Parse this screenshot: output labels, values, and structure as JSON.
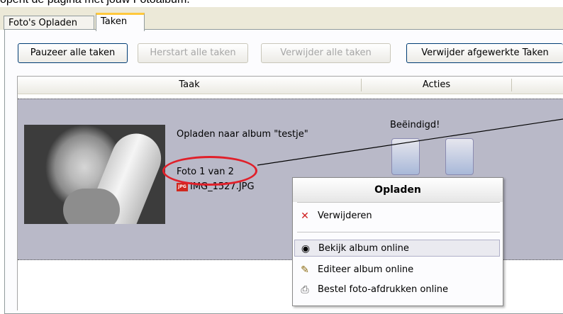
{
  "top_text": "opent de pagina met jouw Fotoalbum.",
  "tabs": [
    {
      "label": "Foto's Opladen"
    },
    {
      "label": "Taken"
    }
  ],
  "buttons": {
    "pause_all": "Pauzeer alle taken",
    "restart_all": "Herstart alle taken",
    "remove_all": "Verwijder alle taken",
    "remove_finished": "Verwijder afgewerkte Taken"
  },
  "grid": {
    "columns": [
      "Taak",
      "Acties"
    ],
    "row": {
      "upload_text": "Opladen naar album \"testje\"",
      "progress_text": "Foto 1 van 2",
      "file_name": "IMG_1527.JPG",
      "file_badge": "JPG",
      "status": "Beëindigd!"
    }
  },
  "context_menu": {
    "title": "Opladen",
    "items": [
      {
        "label": "Verwijderen",
        "icon": "red-x-icon"
      },
      {
        "label": "Bekijk album online",
        "icon": "eye-icon"
      },
      {
        "label": "Editeer album online",
        "icon": "pencil-icon"
      },
      {
        "label": "Bestel foto-afdrukken online",
        "icon": "printer-icon"
      }
    ]
  },
  "colors": {
    "row_bg": "#b9b9c8",
    "oval": "#e0202a",
    "tab_accent": "#ffc83c"
  }
}
